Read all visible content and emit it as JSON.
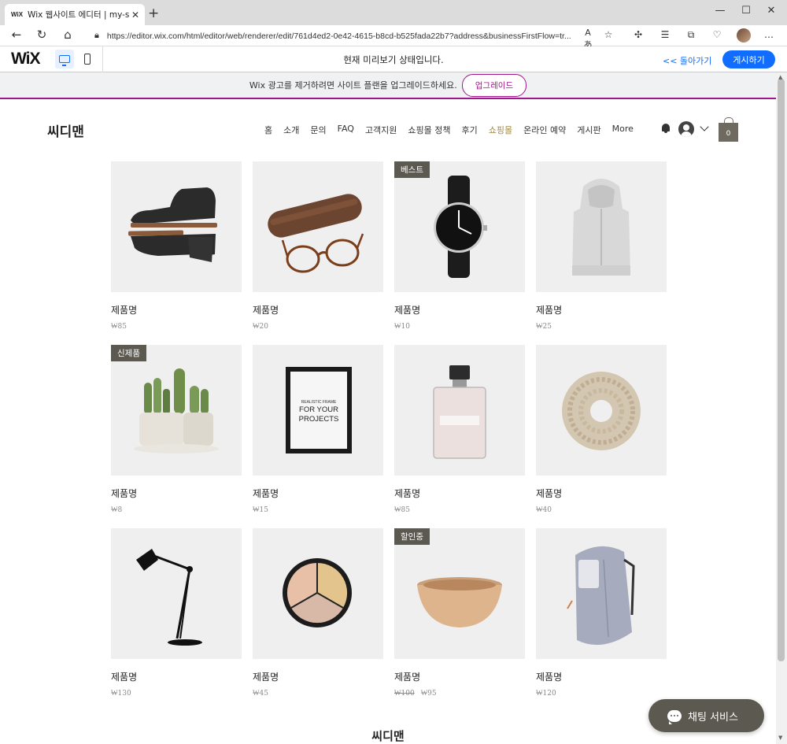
{
  "browser": {
    "tab_favicon": "WiX",
    "tab_title": "Wix 웹사이트 에디터 | my-site",
    "url": "https://editor.wix.com/html/editor/web/renderer/edit/761d4ed2-0e42-4615-b8cd-b525fada22b7?address&businessFirstFlow=tr..."
  },
  "editor": {
    "logo": "WiX",
    "preview_text": "현재 미리보기 상태입니다.",
    "back_link": "<< 돌아가기",
    "publish_label": "게시하기"
  },
  "banner": {
    "text": "Wix 광고를 제거하려면 사이트 플랜을 업그레이드하세요.",
    "button": "업그레이드"
  },
  "site": {
    "name": "씨디맨",
    "nav": [
      "홈",
      "소개",
      "문의",
      "FAQ",
      "고객지원",
      "쇼핑몰 정책",
      "후기",
      "쇼핑몰",
      "온라인 예약",
      "게시판",
      "More"
    ],
    "active_nav": "쇼핑몰",
    "cart_count": "0",
    "footer_name": "씨디맨"
  },
  "products": [
    {
      "name": "제품명",
      "price": "₩85",
      "ribbon": "",
      "icon": "chukka-boots"
    },
    {
      "name": "제품명",
      "price": "₩20",
      "ribbon": "",
      "icon": "glasses-case"
    },
    {
      "name": "제품명",
      "price": "₩10",
      "ribbon": "베스트",
      "icon": "wrist-watch"
    },
    {
      "name": "제품명",
      "price": "₩25",
      "ribbon": "",
      "icon": "hoodie"
    },
    {
      "name": "제품명",
      "price": "₩8",
      "ribbon": "신제품",
      "icon": "cactus-planter"
    },
    {
      "name": "제품명",
      "price": "₩15",
      "ribbon": "",
      "icon": "picture-frame"
    },
    {
      "name": "제품명",
      "price": "₩85",
      "ribbon": "",
      "icon": "perfume-bottle"
    },
    {
      "name": "제품명",
      "price": "₩40",
      "ribbon": "",
      "icon": "knit-scarf"
    },
    {
      "name": "제품명",
      "price": "₩130",
      "ribbon": "",
      "icon": "desk-lamp"
    },
    {
      "name": "제품명",
      "price": "₩45",
      "ribbon": "",
      "icon": "concealer-palette"
    },
    {
      "name": "제품명",
      "price": "₩95",
      "old_price": "₩100",
      "ribbon": "할인중",
      "icon": "wooden-bowl"
    },
    {
      "name": "제품명",
      "price": "₩120",
      "ribbon": "",
      "icon": "backpack"
    }
  ],
  "frame_text": {
    "line1": "REALISTIC FRAME",
    "line2": "FOR YOUR",
    "line3": "PROJECTS"
  },
  "chat": {
    "label": "채팅 서비스"
  },
  "colors": {
    "accent": "#116dff",
    "brand_upgrade": "#a0178d",
    "ribbon": "#5c5a50",
    "active_nav": "#a08a44"
  }
}
